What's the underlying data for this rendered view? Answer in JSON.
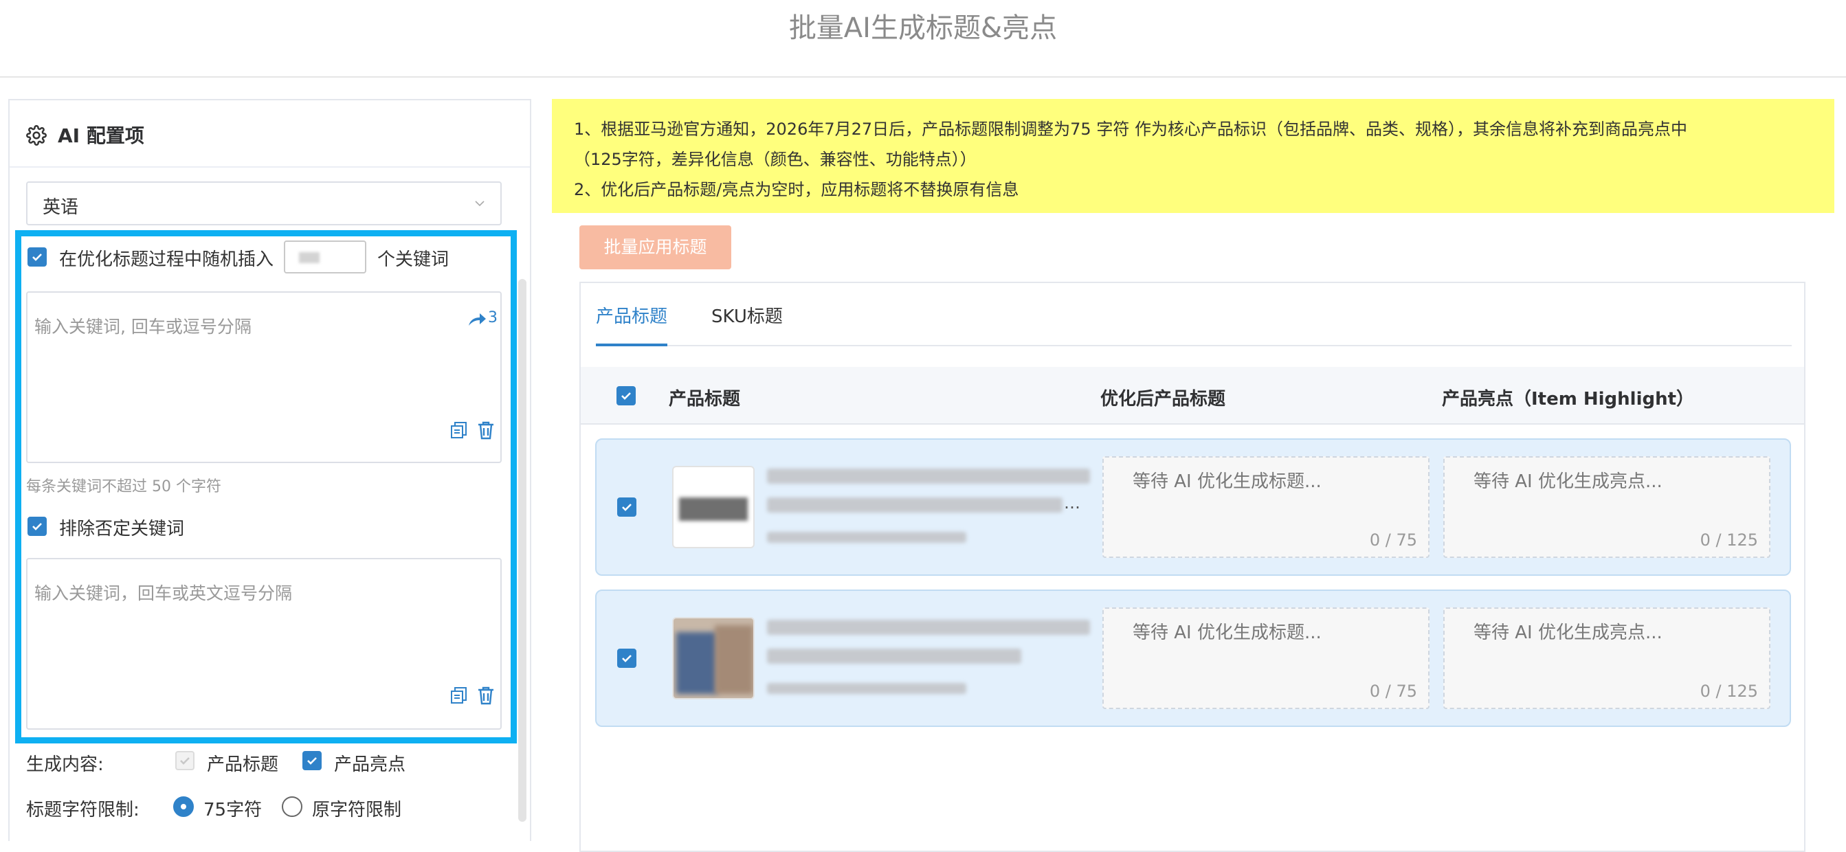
{
  "page": {
    "title": "批量AI生成标题&亮点"
  },
  "config": {
    "title": "AI 配置项",
    "language": "英语",
    "random_insert": {
      "prefix": "在优化标题过程中随机插入",
      "suffix": "个关键词"
    },
    "keywords": {
      "placeholder": "输入关键词, 回车或逗号分隔",
      "count": "3",
      "hint": "每条关键词不超过 50 个字符"
    },
    "exclude": {
      "label": "排除否定关键词",
      "placeholder": "输入关键词，回车或英文逗号分隔"
    },
    "generate": {
      "label": "生成内容:",
      "options": [
        "产品标题",
        "产品亮点"
      ]
    },
    "limit": {
      "label": "标题字符限制:",
      "options": [
        "75字符",
        "原字符限制"
      ]
    }
  },
  "notice": {
    "lines": [
      "1、根据亚马逊官方通知，2026年7月27日后，产品标题限制调整为75 字符 作为核心产品标识（包括品牌、品类、规格），其余信息将补充到商品亮点中",
      "（125字符，差异化信息（颜色、兼容性、功能特点））",
      "2、优化后产品标题/亮点为空时，应用标题将不替换原有信息"
    ]
  },
  "actions": {
    "apply": "批量应用标题"
  },
  "tabs": [
    "产品标题",
    "SKU标题"
  ],
  "table": {
    "headers": [
      "产品标题",
      "优化后产品标题",
      "产品亮点（Item Highlight）"
    ],
    "rows": [
      {
        "ellipsis": "…",
        "title_placeholder": "等待 AI 优化生成标题...",
        "title_count": "0 / 75",
        "highlight_placeholder": "等待 AI 优化生成亮点...",
        "highlight_count": "0 / 125"
      },
      {
        "ellipsis": "",
        "title_placeholder": "等待 AI 优化生成标题...",
        "title_count": "0 / 75",
        "highlight_placeholder": "等待 AI 优化生成亮点...",
        "highlight_count": "0 / 125"
      }
    ]
  },
  "colors": {
    "primary": "#2f82c9",
    "notice_bg": "#ffff7d",
    "highlight_border": "#0eb0f2",
    "apply_button": "#f8bba2"
  }
}
